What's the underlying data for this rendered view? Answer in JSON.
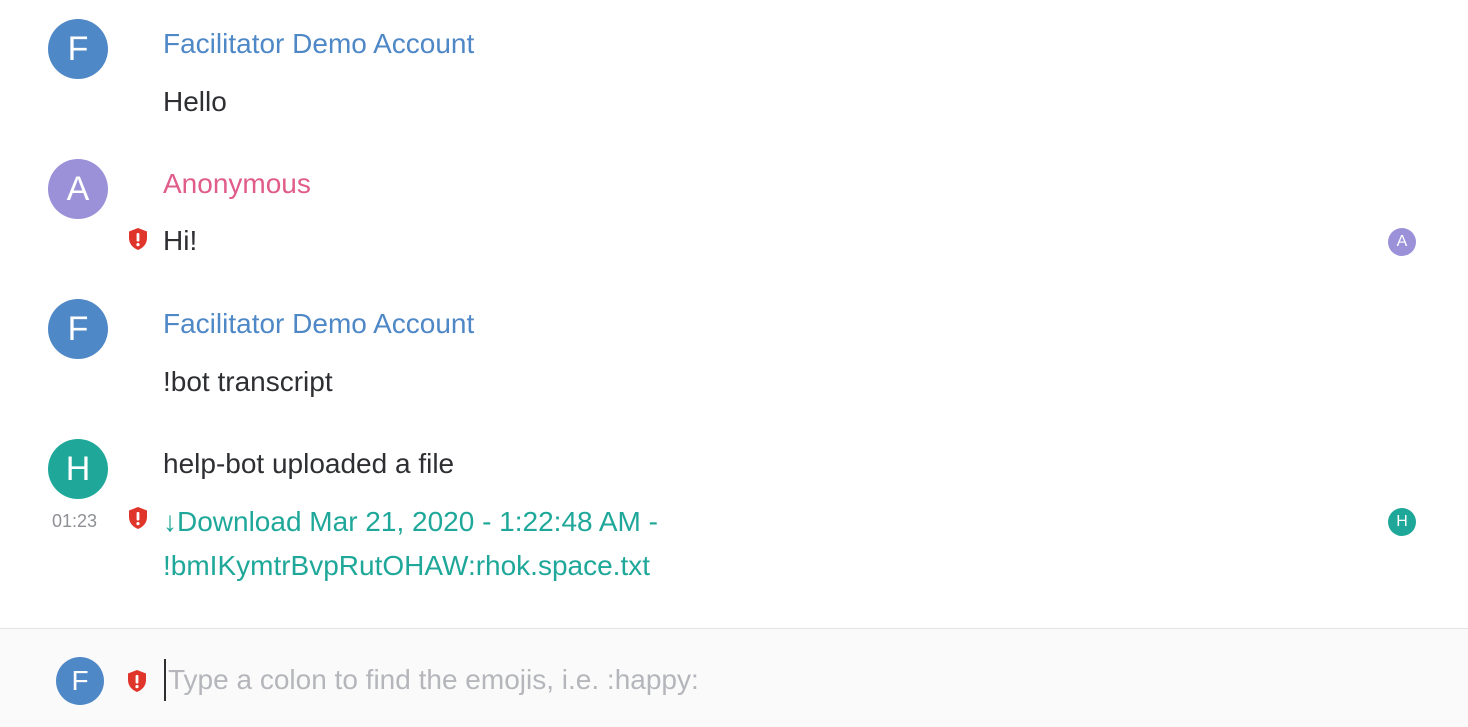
{
  "colors": {
    "facilitator": "#4f88c6",
    "anonymous": "#e05c8a",
    "anonymous_avatar": "#9b91d9",
    "helpbot": "#1fa89a",
    "shield": "#e0352b"
  },
  "messages": [
    {
      "avatar_letter": "F",
      "sender": "Facilitator Demo Account",
      "body": "Hello"
    },
    {
      "avatar_letter": "A",
      "sender": "Anonymous",
      "body": "Hi!",
      "read_receipt": "A",
      "icon": "shield-warning-icon"
    },
    {
      "avatar_letter": "F",
      "sender": "Facilitator Demo Account",
      "body": "!bot transcript"
    },
    {
      "avatar_letter": "H",
      "body": "help-bot uploaded a file",
      "timestamp": "01:23",
      "file_arrow": "↓",
      "file_line1": "Download Mar 21, 2020 - 1:22:48 AM -",
      "file_line2": "!bmIKymtrBvpRutOHAW:rhok.space.txt",
      "read_receipt": "H",
      "icon": "shield-warning-icon"
    }
  ],
  "composer": {
    "avatar_letter": "F",
    "placeholder": "Type a colon to find the emojis, i.e. :happy:",
    "icon": "shield-warning-icon"
  }
}
